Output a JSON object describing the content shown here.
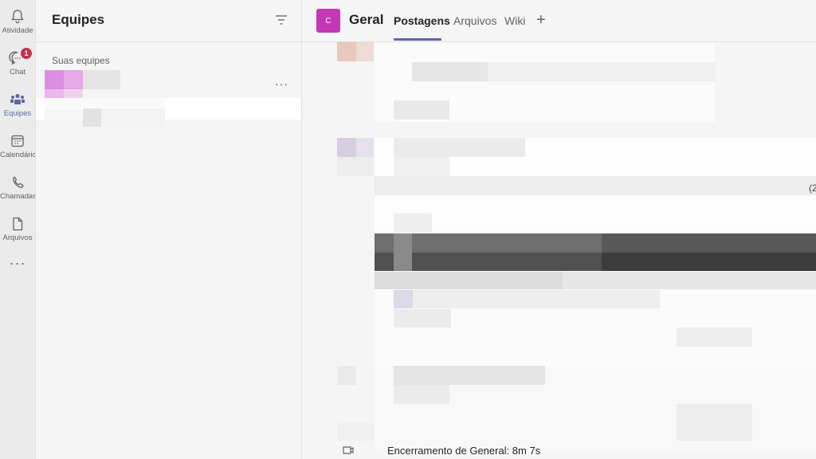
{
  "rail": {
    "items": [
      {
        "label": "Atividade",
        "icon": "bell-icon"
      },
      {
        "label": "Chat",
        "icon": "chat-icon",
        "badge": "1"
      },
      {
        "label": "Equipes",
        "icon": "teams-icon"
      },
      {
        "label": "Calendário",
        "icon": "calendar-icon"
      },
      {
        "label": "Chamadas",
        "icon": "phone-icon"
      },
      {
        "label": "Arquivos",
        "icon": "file-icon"
      }
    ],
    "more": "···"
  },
  "teams_panel": {
    "title": "Equipes",
    "section_label": "Suas equipes",
    "team_more": "···"
  },
  "channel": {
    "avatar_letter": "C",
    "name": "Geral",
    "tabs": [
      {
        "label": "Postagens",
        "active": true
      },
      {
        "label": "Arquivos",
        "active": false
      },
      {
        "label": "Wiki",
        "active": false
      }
    ],
    "add_tab": "+"
  },
  "feed": {
    "last_message": "Encerramento de General: 8m 7s",
    "truncated_edge_text": "(2"
  },
  "colors": {
    "accent": "#6264a7",
    "badge": "#c4314b",
    "channel_avatar": "#c239b3",
    "arrow": "#d0021b"
  }
}
